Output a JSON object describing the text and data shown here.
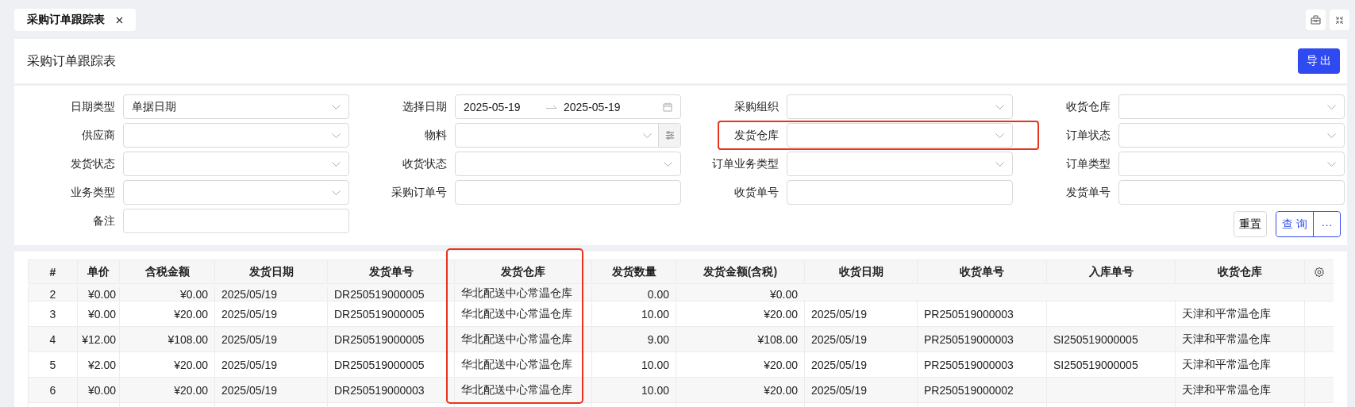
{
  "tabs": [
    {
      "label": "采购订单跟踪表",
      "selected": true
    }
  ],
  "header": {
    "title": "采购订单跟踪表",
    "export_button": "导 出"
  },
  "filters": [
    {
      "label": "日期类型",
      "kind": "select",
      "value": "单据日期",
      "highlighted": false
    },
    {
      "label": "选择日期",
      "kind": "date-range",
      "start": "2025-05-19",
      "end": "2025-05-19",
      "highlighted": false
    },
    {
      "label": "采购组织",
      "kind": "select",
      "highlighted": false
    },
    {
      "label": "收货仓库",
      "kind": "select",
      "highlighted": false
    },
    {
      "label": "供应商",
      "kind": "select",
      "highlighted": false
    },
    {
      "label": "物料",
      "kind": "picker",
      "highlighted": false
    },
    {
      "label": "发货仓库",
      "kind": "select",
      "highlighted": true
    },
    {
      "label": "订单状态",
      "kind": "select",
      "highlighted": false
    },
    {
      "label": "发货状态",
      "kind": "select",
      "highlighted": false
    },
    {
      "label": "收货状态",
      "kind": "select",
      "highlighted": false
    },
    {
      "label": "订单业务类型",
      "kind": "select",
      "highlighted": false
    },
    {
      "label": "订单类型",
      "kind": "select",
      "highlighted": false
    },
    {
      "label": "业务类型",
      "kind": "select",
      "highlighted": false
    },
    {
      "label": "采购订单号",
      "kind": "text",
      "highlighted": false
    },
    {
      "label": "收货单号",
      "kind": "text",
      "highlighted": false
    },
    {
      "label": "发货单号",
      "kind": "text",
      "highlighted": false
    },
    {
      "label": "备注",
      "kind": "text",
      "highlighted": false
    }
  ],
  "filter_buttons": {
    "reset": "重置",
    "query": "查 询",
    "more": "···"
  },
  "table": {
    "columns": [
      {
        "label": "#",
        "highlighted": false
      },
      {
        "label": "单价",
        "highlighted": false
      },
      {
        "label": "含税金额",
        "highlighted": false
      },
      {
        "label": "发货日期",
        "highlighted": false
      },
      {
        "label": "发货单号",
        "highlighted": false
      },
      {
        "label": "发货仓库",
        "highlighted": true
      },
      {
        "label": "发货数量",
        "highlighted": false
      },
      {
        "label": "发货金额(含税)",
        "highlighted": false
      },
      {
        "label": "收货日期",
        "highlighted": false
      },
      {
        "label": "收货单号",
        "highlighted": false
      },
      {
        "label": "入库单号",
        "highlighted": false
      },
      {
        "label": "收货仓库",
        "highlighted": false
      }
    ],
    "rows": [
      {
        "cells": [
          "2",
          "¥0.00",
          "¥0.00",
          "2025/05/19",
          "DR250519000005",
          "华北配送中心常温仓库",
          "0.00",
          "¥0.00",
          "",
          "",
          "",
          ""
        ]
      },
      {
        "cells": [
          "3",
          "¥0.00",
          "¥20.00",
          "2025/05/19",
          "DR250519000005",
          "华北配送中心常温仓库",
          "10.00",
          "¥20.00",
          "2025/05/19",
          "PR250519000003",
          "",
          "天津和平常温仓库"
        ]
      },
      {
        "cells": [
          "4",
          "¥12.00",
          "¥108.00",
          "2025/05/19",
          "DR250519000005",
          "华北配送中心常温仓库",
          "9.00",
          "¥108.00",
          "2025/05/19",
          "PR250519000003",
          "SI250519000005",
          "天津和平常温仓库"
        ]
      },
      {
        "cells": [
          "5",
          "¥2.00",
          "¥20.00",
          "2025/05/19",
          "DR250519000005",
          "华北配送中心常温仓库",
          "10.00",
          "¥20.00",
          "2025/05/19",
          "PR250519000003",
          "SI250519000005",
          "天津和平常温仓库"
        ]
      },
      {
        "cells": [
          "6",
          "¥0.00",
          "¥20.00",
          "2025/05/19",
          "DR250519000003",
          "华北配送中心常温仓库",
          "10.00",
          "¥20.00",
          "2025/05/19",
          "PR250519000002",
          "",
          "天津和平常温仓库"
        ]
      }
    ]
  }
}
